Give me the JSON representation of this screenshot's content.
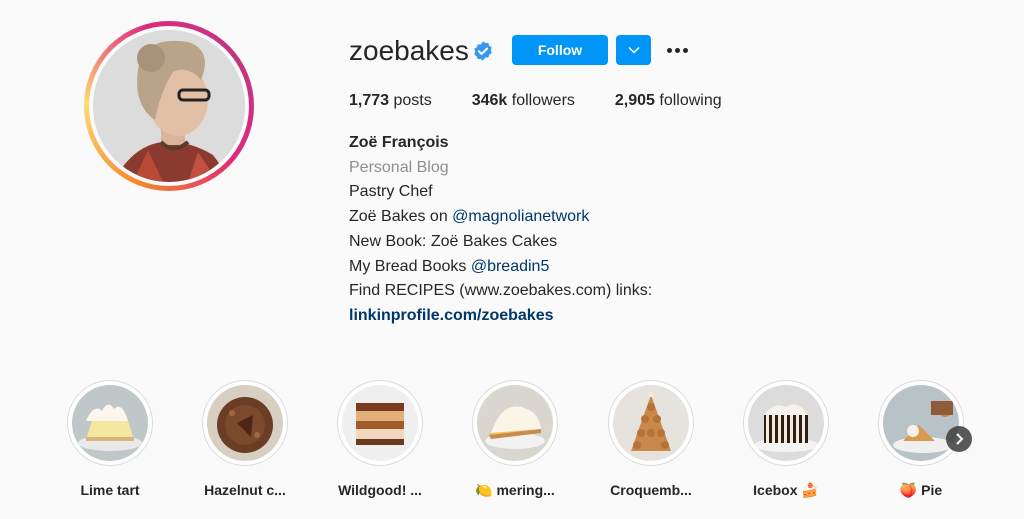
{
  "profile": {
    "username": "zoebakes",
    "verified_icon": "verified-badge-icon",
    "follow_label": "Follow",
    "accent_color": "#0095f6",
    "avatar_ring_colors": [
      "#f58529",
      "#dd2a7b",
      "#c13584"
    ]
  },
  "stats": {
    "posts_count": "1,773",
    "posts_label": " posts",
    "followers_count": "346k",
    "followers_label": " followers",
    "following_count": "2,905",
    "following_label": " following"
  },
  "bio": {
    "full_name": "Zoë François",
    "category": "Personal Blog",
    "line1": "Pastry Chef",
    "line2_text": "Zoë Bakes on ",
    "line2_mention": "@magnolianetwork",
    "line3": "New Book: Zoë Bakes Cakes",
    "line4_text": "My Bread Books ",
    "line4_mention": "@breadin5",
    "line5": "Find RECIPES (www.zoebakes.com) links:",
    "link": "linkinprofile.com/zoebakes"
  },
  "highlights": [
    {
      "label": "Lime tart"
    },
    {
      "label": "Hazelnut c..."
    },
    {
      "label": "Wildgood! ..."
    },
    {
      "label": "🍋 mering..."
    },
    {
      "label": "Croquemb..."
    },
    {
      "label": "Icebox 🍰"
    },
    {
      "label": "🍑 Pie"
    }
  ]
}
